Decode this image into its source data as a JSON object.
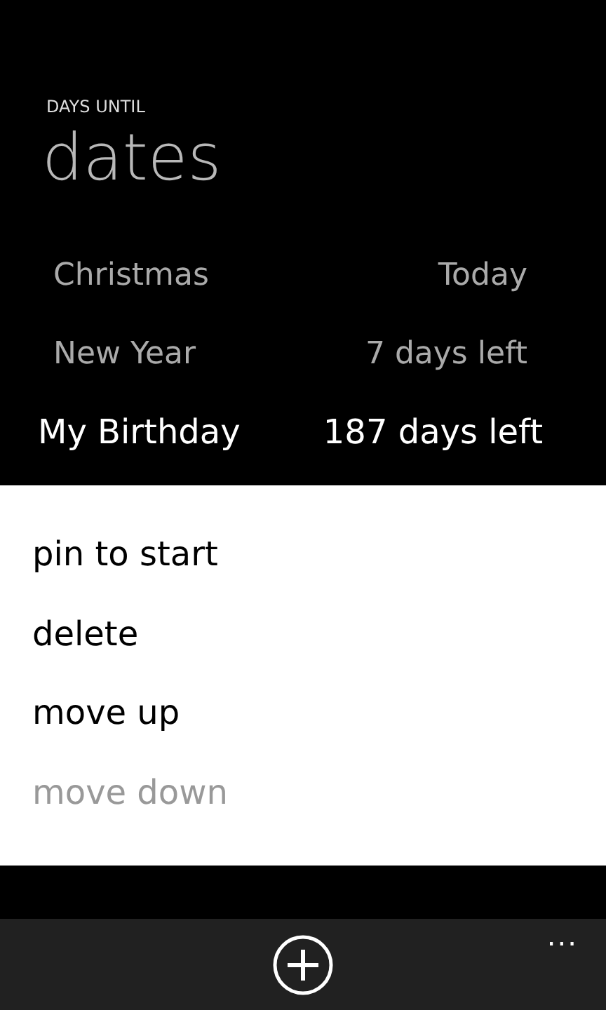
{
  "header": {
    "app_title": "DAYS UNTIL",
    "page_title": "dates"
  },
  "events": [
    {
      "name": "Christmas",
      "remaining": "Today",
      "selected": false
    },
    {
      "name": "New Year",
      "remaining": "7 days left",
      "selected": false
    },
    {
      "name": "My Birthday",
      "remaining": "187 days left",
      "selected": true
    }
  ],
  "context_menu": [
    {
      "label": "pin to start",
      "disabled": false
    },
    {
      "label": "delete",
      "disabled": false
    },
    {
      "label": "move up",
      "disabled": false
    },
    {
      "label": "move down",
      "disabled": true
    }
  ],
  "app_bar": {
    "more": "..."
  }
}
